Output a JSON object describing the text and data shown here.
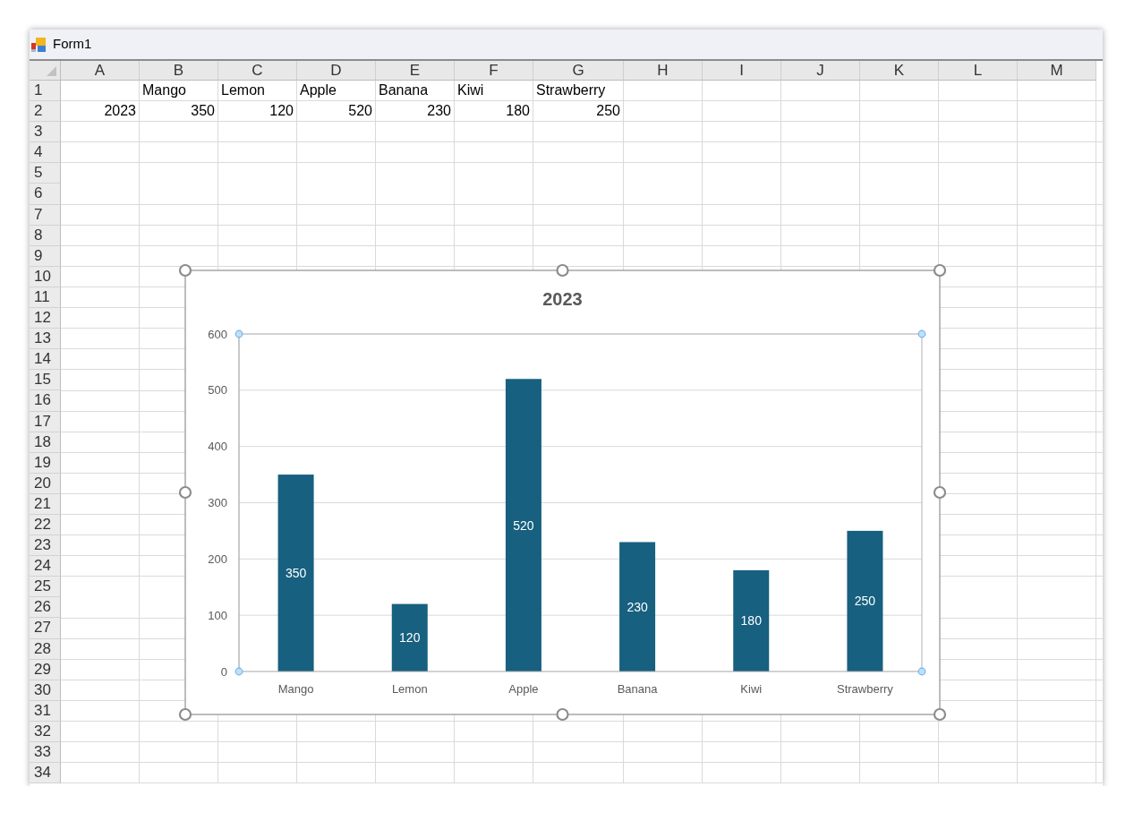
{
  "window": {
    "title": "Form1"
  },
  "sheet": {
    "columns": [
      "A",
      "B",
      "C",
      "D",
      "E",
      "F",
      "G",
      "H",
      "I",
      "J",
      "K",
      "L",
      "M"
    ],
    "rows": [
      {
        "label": "1",
        "cells": [
          {
            "kind": "empty"
          },
          {
            "kind": "text",
            "text": "Mango"
          },
          {
            "kind": "text",
            "text": "Lemon"
          },
          {
            "kind": "text",
            "text": "Apple"
          },
          {
            "kind": "text",
            "text": "Banana"
          },
          {
            "kind": "text",
            "text": "Kiwi"
          },
          {
            "kind": "text",
            "text": "Strawberry"
          }
        ]
      },
      {
        "label": "2",
        "cells": [
          {
            "kind": "number",
            "text": "2023"
          },
          {
            "kind": "number",
            "text": "350"
          },
          {
            "kind": "number",
            "text": "120"
          },
          {
            "kind": "number",
            "text": "520"
          },
          {
            "kind": "number",
            "text": "230"
          },
          {
            "kind": "number",
            "text": "180"
          },
          {
            "kind": "number",
            "text": "250"
          }
        ]
      },
      {
        "label": "3"
      },
      {
        "label": "4"
      },
      {
        "label": "5"
      },
      {
        "label": "6"
      },
      {
        "label": "7"
      },
      {
        "label": "8"
      },
      {
        "label": "9"
      },
      {
        "label": "10"
      },
      {
        "label": "11"
      },
      {
        "label": "12"
      },
      {
        "label": "13"
      },
      {
        "label": "14"
      },
      {
        "label": "15"
      },
      {
        "label": "16"
      },
      {
        "label": "17"
      },
      {
        "label": "18"
      },
      {
        "label": "19"
      },
      {
        "label": "20"
      },
      {
        "label": "21"
      },
      {
        "label": "22"
      },
      {
        "label": "23"
      },
      {
        "label": "24"
      },
      {
        "label": "25"
      },
      {
        "label": "26"
      },
      {
        "label": "27"
      },
      {
        "label": "28"
      },
      {
        "label": "29"
      },
      {
        "label": "30"
      },
      {
        "label": "31"
      },
      {
        "label": "32"
      },
      {
        "label": "33"
      },
      {
        "label": "34"
      }
    ]
  },
  "chart": {
    "selected": true,
    "chart_data": {
      "type": "bar",
      "title": "2023",
      "categories": [
        "Mango",
        "Lemon",
        "Apple",
        "Banana",
        "Kiwi",
        "Strawberry"
      ],
      "values": [
        350,
        120,
        520,
        230,
        180,
        250
      ],
      "ylim": [
        0,
        600
      ],
      "yticks": [
        0,
        100,
        200,
        300,
        400,
        500,
        600
      ],
      "grid": true,
      "data_labels": true
    }
  }
}
